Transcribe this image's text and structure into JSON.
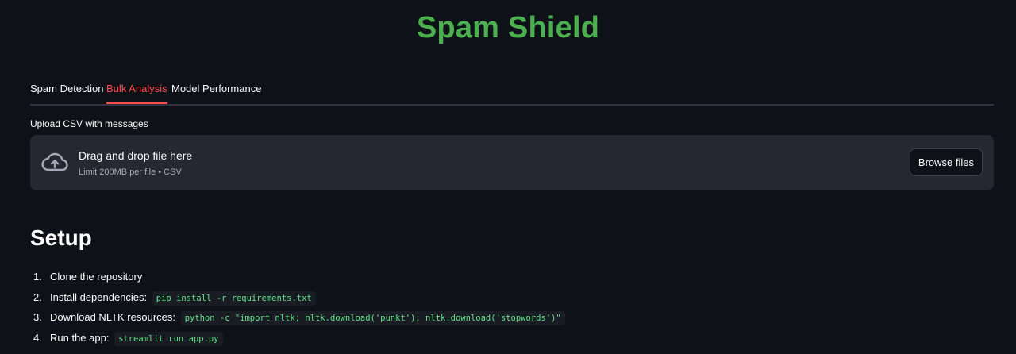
{
  "app": {
    "title": "Spam Shield",
    "accent": "#4caf50"
  },
  "tabs": [
    {
      "label": "Spam Detection",
      "active": false
    },
    {
      "label": "Bulk Analysis",
      "active": true
    },
    {
      "label": "Model Performance",
      "active": false
    }
  ],
  "uploader": {
    "label": "Upload CSV with messages",
    "drop_text": "Drag and drop file here",
    "limit_text": "Limit 200MB per file • CSV",
    "browse_label": "Browse files",
    "icon": "cloud-upload-icon"
  },
  "setup": {
    "heading": "Setup",
    "steps": [
      {
        "num": "1.",
        "text": "Clone the repository",
        "code": ""
      },
      {
        "num": "2.",
        "text": "Install dependencies:",
        "code": "pip install -r requirements.txt"
      },
      {
        "num": "3.",
        "text": "Download NLTK resources:",
        "code": "python -c \"import nltk; nltk.download('punkt'); nltk.download('stopwords')\""
      },
      {
        "num": "4.",
        "text": "Run the app:",
        "code": "streamlit run app.py"
      }
    ]
  },
  "colors": {
    "background": "#0e1117",
    "active_tab": "#ff4b4b",
    "code_text": "#5ce488",
    "dropzone": "#262730"
  }
}
